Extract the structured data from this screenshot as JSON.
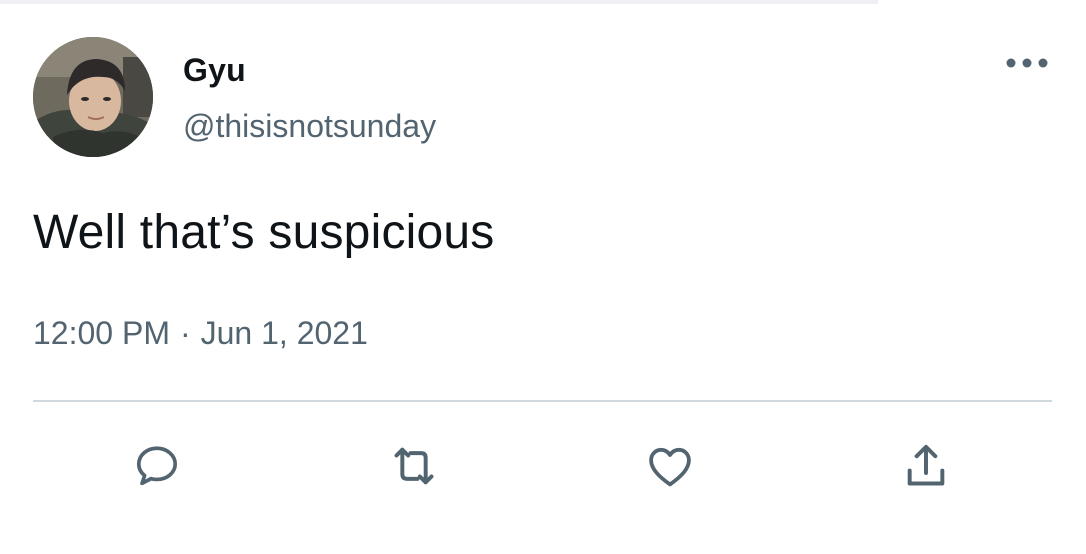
{
  "tweet": {
    "author": {
      "name": "Gyu",
      "handle": "@thisisnotsunday"
    },
    "text": "Well that’s suspicious",
    "time": "12:00 PM",
    "separator": "·",
    "date": "Jun 1, 2021"
  },
  "actions": [
    "reply-icon",
    "retweet-icon",
    "like-icon",
    "share-icon"
  ],
  "menu_icon": "more-options-icon",
  "colors": {
    "text_primary": "#0f1419",
    "text_secondary": "#536471",
    "icon": "#536471",
    "divider": "#cfd9de"
  }
}
